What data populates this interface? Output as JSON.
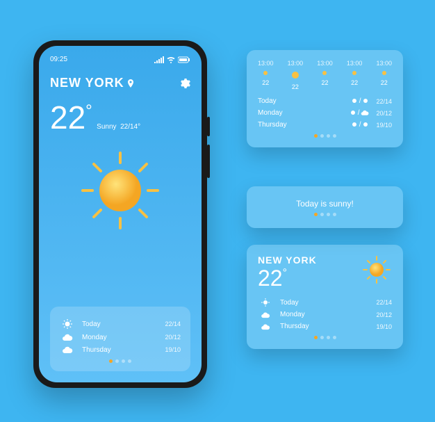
{
  "status": {
    "time": "09:25"
  },
  "city": "NEW YORK",
  "current": {
    "temp": "22",
    "condition": "Sunny",
    "range": "22/14°"
  },
  "forecast": [
    {
      "icon": "sun",
      "day": "Today",
      "vals": "22/14"
    },
    {
      "icon": "cloud",
      "day": "Monday",
      "vals": "20/12"
    },
    {
      "icon": "cloud",
      "day": "Thursday",
      "vals": "19/10"
    }
  ],
  "widget1": {
    "hourly": [
      {
        "time": "13:00",
        "temp": "22",
        "icon": "sun-small"
      },
      {
        "time": "13:00",
        "temp": "22",
        "icon": "sun"
      },
      {
        "time": "13:00",
        "temp": "22",
        "icon": "sun-small"
      },
      {
        "time": "13:00",
        "temp": "22",
        "icon": "sun-small"
      },
      {
        "time": "13:00",
        "temp": "22",
        "icon": "sun-small"
      }
    ],
    "rows": [
      {
        "day": "Today",
        "vals": "22/14"
      },
      {
        "day": "Monday",
        "vals": "20/12"
      },
      {
        "day": "Thursday",
        "vals": "19/10"
      }
    ]
  },
  "widget2": {
    "message": "Today is sunny!"
  },
  "widget3": {
    "city": "NEW YORK",
    "temp": "22",
    "rows": [
      {
        "day": "Today",
        "vals": "22/14"
      },
      {
        "day": "Monday",
        "vals": "20/12"
      },
      {
        "day": "Thursday",
        "vals": "19/10"
      }
    ]
  }
}
